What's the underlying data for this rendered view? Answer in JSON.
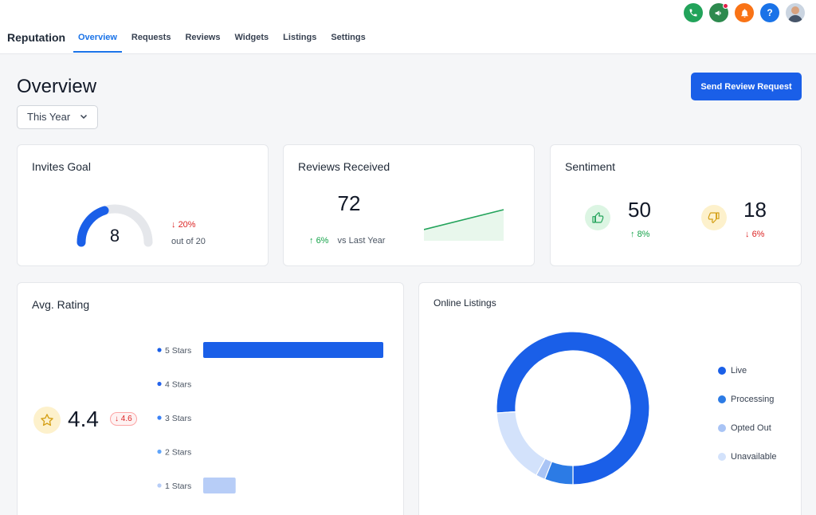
{
  "app": {
    "title": "Reputation"
  },
  "tabs": [
    {
      "label": "Overview",
      "active": true
    },
    {
      "label": "Requests",
      "active": false
    },
    {
      "label": "Reviews",
      "active": false
    },
    {
      "label": "Widgets",
      "active": false
    },
    {
      "label": "Listings",
      "active": false
    },
    {
      "label": "Settings",
      "active": false
    }
  ],
  "header_icons": {
    "phone": {
      "icon": "phone-icon",
      "color": "#22a35a"
    },
    "announce": {
      "icon": "megaphone-icon",
      "color": "#2d8a4e"
    },
    "bell": {
      "icon": "bell-icon",
      "color": "#f97316"
    },
    "help": {
      "icon": "help-icon",
      "label": "?",
      "color": "#1a73e8"
    }
  },
  "page": {
    "title": "Overview",
    "primary_button": "Send Review Request",
    "period": "This Year"
  },
  "invites_goal": {
    "title": "Invites Goal",
    "value": "8",
    "goal": 20,
    "change": "20%",
    "change_direction": "down",
    "subtext": "out of 20"
  },
  "reviews_received": {
    "title": "Reviews Received",
    "value": "72",
    "change": "6%",
    "change_direction": "up",
    "compare_label": "vs Last Year"
  },
  "sentiment": {
    "title": "Sentiment",
    "positive": {
      "value": "50",
      "change": "8%",
      "change_direction": "up",
      "icon": "thumbs-up-icon"
    },
    "negative": {
      "value": "18",
      "change": "6%",
      "change_direction": "down",
      "icon": "thumbs-down-icon"
    }
  },
  "avg_rating": {
    "title": "Avg. Rating",
    "value": "4.4",
    "badge": "4.6",
    "badge_direction": "down",
    "chart_data": {
      "type": "bar",
      "orientation": "horizontal",
      "categories": [
        "5 Stars",
        "4 Stars",
        "3 Stars",
        "2 Stars",
        "1 Stars"
      ],
      "values": [
        1.0,
        0,
        0,
        0,
        0.18
      ],
      "colors": [
        "#1a5fe8",
        "#2563eb",
        "#3b82f6",
        "#60a5fa",
        "#b7cdf7"
      ]
    }
  },
  "online_listings": {
    "title": "Online Listings",
    "chart_data": {
      "type": "pie",
      "donut": true,
      "categories": [
        "Live",
        "Processing",
        "Opted Out",
        "Unavailable"
      ],
      "values": [
        76,
        6,
        2,
        16
      ],
      "colors": [
        "#1a5fe8",
        "#2c7be5",
        "#a9c4f5",
        "#d3e2fb"
      ]
    }
  }
}
